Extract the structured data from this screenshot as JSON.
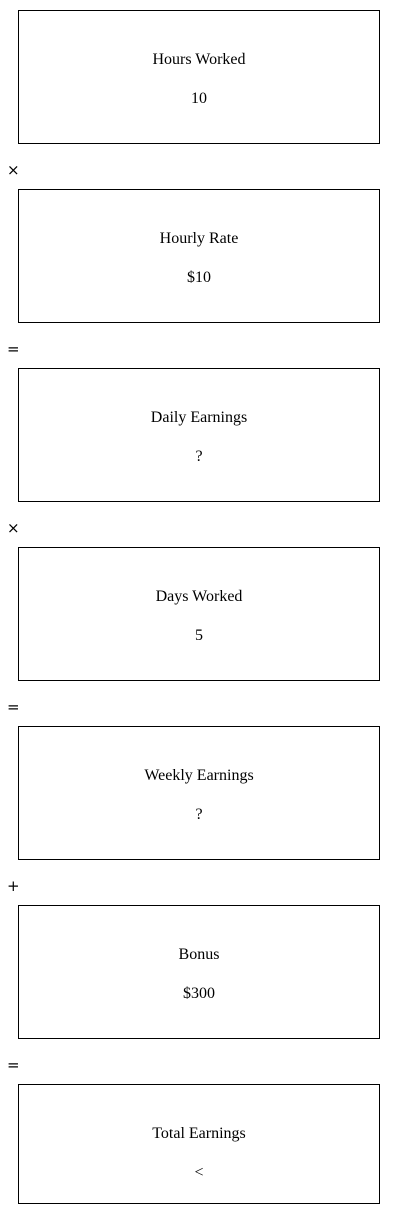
{
  "steps": [
    {
      "label": "Hours Worked",
      "value": "10"
    },
    {
      "label": "Hourly Rate",
      "value": "$10"
    },
    {
      "label": "Daily Earnings",
      "value": "?"
    },
    {
      "label": "Days Worked",
      "value": "5"
    },
    {
      "label": "Weekly Earnings",
      "value": "?"
    },
    {
      "label": "Bonus",
      "value": "$300"
    },
    {
      "label": "Total Earnings",
      "value": "<"
    }
  ],
  "operators": [
    "×",
    "=",
    "×",
    "=",
    "+",
    "="
  ]
}
